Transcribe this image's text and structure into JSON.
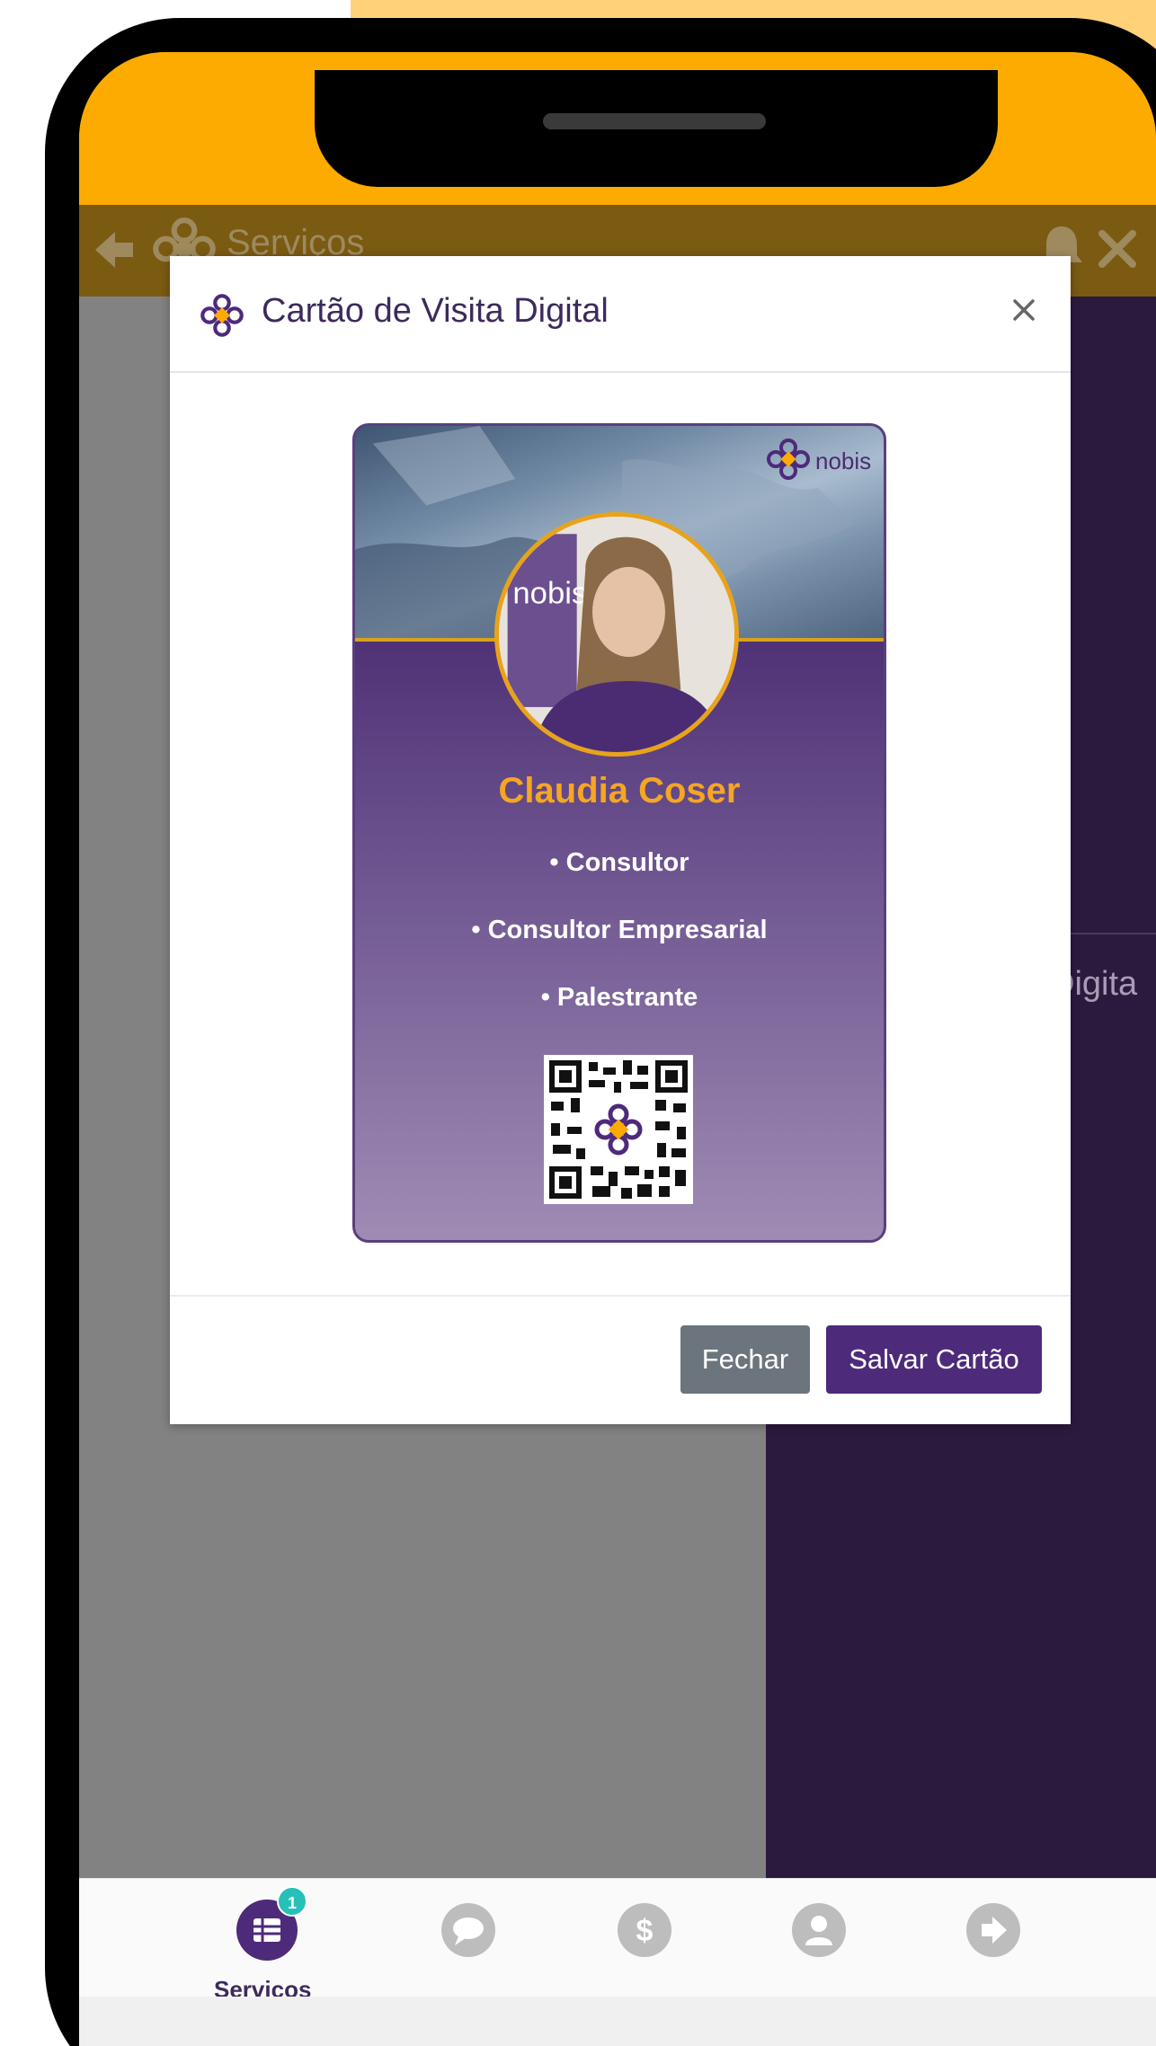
{
  "appbar": {
    "title": "Serviços"
  },
  "background_peek": {
    "text": "Digita"
  },
  "modal": {
    "title": "Cartão de Visita Digital",
    "close_symbol": "×",
    "buttons": {
      "close": "Fechar",
      "save": "Salvar Cartão"
    }
  },
  "card": {
    "brand": "nobis",
    "photo_brand": "nobis",
    "name": "Claudia Coser",
    "roles": [
      "• Consultor",
      "• Consultor Empresarial",
      "• Palestrante"
    ]
  },
  "bottom_nav": {
    "items": [
      {
        "label": "Serviços",
        "icon": "table-icon",
        "badge": "1",
        "active": true
      },
      {
        "label": "",
        "icon": "chat-icon"
      },
      {
        "label": "",
        "icon": "dollar-icon"
      },
      {
        "label": "",
        "icon": "user-icon"
      },
      {
        "label": "",
        "icon": "logout-icon"
      }
    ]
  },
  "colors": {
    "primary": "#4e2a7a",
    "accent": "#fdab00",
    "name": "#f5a623",
    "badge": "#27c0b8"
  }
}
